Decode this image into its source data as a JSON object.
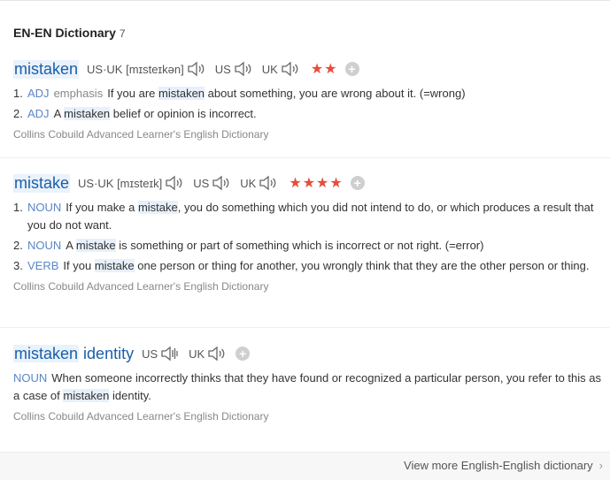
{
  "header": {
    "title": "EN-EN Dictionary",
    "count": "7"
  },
  "entries": [
    {
      "word": "mistaken",
      "word_parts": [
        "mistaken"
      ],
      "pron_us_uk": "US·UK [mɪsteɪkən]",
      "pron_us": "US",
      "pron_uk": "UK",
      "stars": "★★",
      "add": "+",
      "defs": [
        {
          "num": "1.",
          "pos": "ADJ",
          "label": "emphasis",
          "pre": "If you are ",
          "hl": "mistaken",
          "post": " about something, you are wrong about it. (=wrong)"
        },
        {
          "num": "2.",
          "pos": "ADJ",
          "label": "",
          "pre": "A ",
          "hl": "mistaken",
          "post": " belief or opinion is incorrect."
        }
      ],
      "source": "Collins Cobuild Advanced Learner's English Dictionary"
    },
    {
      "word": "mistake",
      "pron_us_uk": "US·UK [mɪsteɪk]",
      "pron_us": "US",
      "pron_uk": "UK",
      "stars": "★★★★",
      "add": "+",
      "defs": [
        {
          "num": "1.",
          "pos": "NOUN",
          "label": "",
          "pre": "If you make a ",
          "hl": "mistake",
          "post": ", you do something which you did not intend to do, or which produces a result that you do not want."
        },
        {
          "num": "2.",
          "pos": "NOUN",
          "label": "",
          "pre": "A ",
          "hl": "mistake",
          "post": " is something or part of something which is incorrect or not right. (=error)"
        },
        {
          "num": "3.",
          "pos": "VERB",
          "label": "",
          "pre": "If you ",
          "hl": "mistake",
          "post": " one person or thing for another, you wrongly think that they are the other person or thing."
        }
      ],
      "source": "Collins Cobuild Advanced Learner's English Dictionary"
    },
    {
      "word_a": "mistaken",
      "word_b": "identity",
      "pron_us": "US",
      "pron_uk": "UK",
      "add": "+",
      "defs": [
        {
          "num": "",
          "pos": "NOUN",
          "label": "",
          "pre": "When someone incorrectly thinks that they have found or recognized a particular person, you refer to this as a case of ",
          "hl": "mistaken",
          "post": " identity."
        }
      ],
      "source": "Collins Cobuild Advanced Learner's English Dictionary"
    }
  ],
  "footer": {
    "view_more": "View more English-English dictionary",
    "chevron": "›"
  },
  "icons": {
    "speaker": "speaker-icon",
    "add": "add-icon",
    "chevron": "chevron-right-icon"
  }
}
